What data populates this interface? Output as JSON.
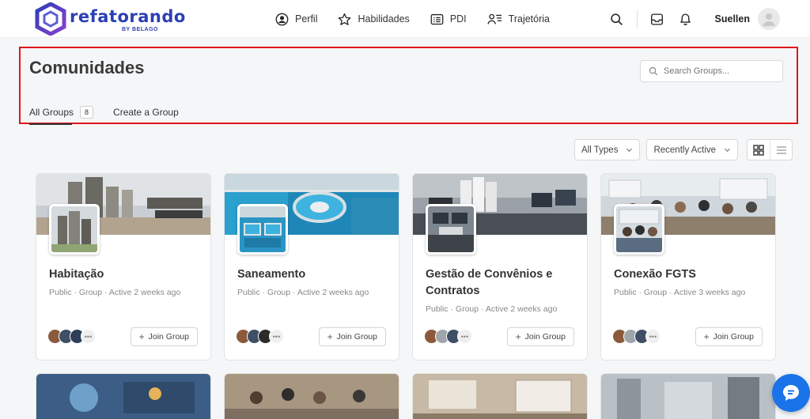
{
  "brand": {
    "name": "refatorando",
    "sub": "BY BELAGO",
    "colors": {
      "primary": "#2b3fb5",
      "accent": "#7a3fc8"
    }
  },
  "nav": {
    "items": [
      {
        "label": "Perfil",
        "icon": "user-circle-icon"
      },
      {
        "label": "Habilidades",
        "icon": "star-icon"
      },
      {
        "label": "PDI",
        "icon": "list-card-icon"
      },
      {
        "label": "Trajetória",
        "icon": "user-list-icon"
      }
    ]
  },
  "header": {
    "user_name": "Suellen"
  },
  "page": {
    "title": "Comunidades",
    "search_placeholder": "Search Groups...",
    "tabs": [
      {
        "label": "All Groups",
        "count": "8"
      },
      {
        "label": "Create a Group"
      }
    ]
  },
  "filters": {
    "type": "All Types",
    "order": "Recently Active"
  },
  "groups": [
    {
      "name": "Habitação",
      "meta": "Public  ·  Group  ·  Active 2 weeks ago",
      "join": "Join Group",
      "more": "•••"
    },
    {
      "name": "Saneamento",
      "meta": "Public  ·  Group  ·  Active 2 weeks ago",
      "join": "Join Group",
      "more": "•••"
    },
    {
      "name": "Gestão de Convênios e Contratos",
      "meta": "Public  ·  Group  ·  Active 2 weeks ago",
      "join": "Join Group",
      "more": "•••"
    },
    {
      "name": "Conexão FGTS",
      "meta": "Public  ·  Group  ·  Active 3 weeks ago",
      "join": "Join Group",
      "more": "•••"
    }
  ]
}
